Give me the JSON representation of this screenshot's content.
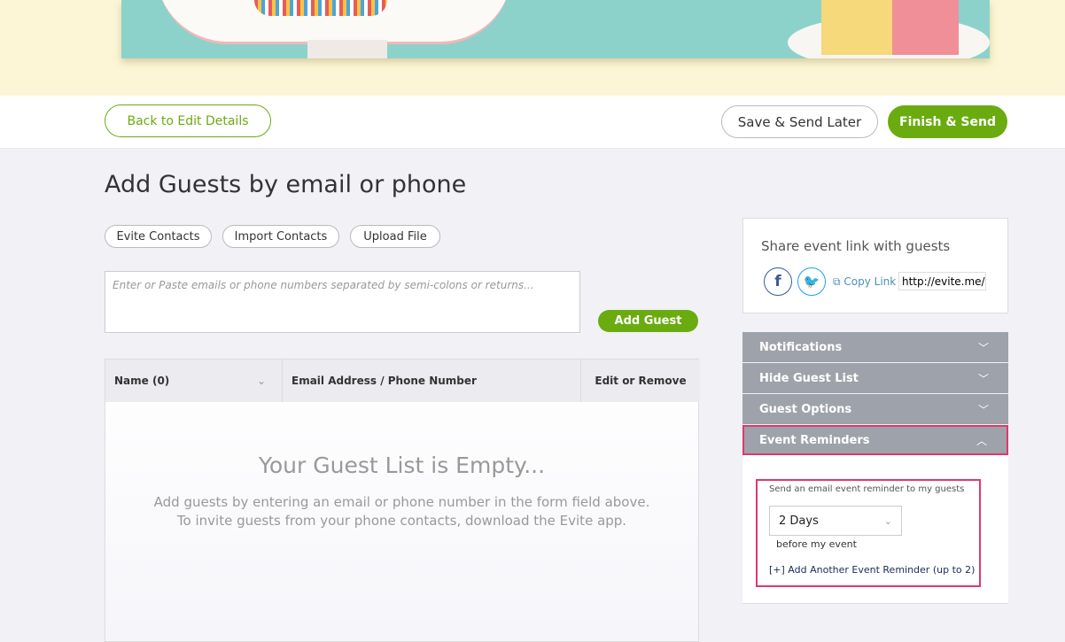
{
  "toolbar": {
    "back": "Back to Edit Details",
    "save_later": "Save & Send Later",
    "finish": "Finish & Send"
  },
  "colors": {
    "accent": "#6aab10",
    "highlight": "#e0386e",
    "accordion": "#9ea3ab"
  },
  "main": {
    "title": "Add Guests by email or phone",
    "sources": [
      "Evite Contacts",
      "Import Contacts",
      "Upload File"
    ],
    "input_placeholder": "Enter or Paste emails or phone numbers separated by semi-colons or returns...",
    "add_guest": "Add Guest",
    "columns": [
      "Name (0)",
      "Email Address / Phone Number",
      "Edit or Remove"
    ],
    "empty_title": "Your Guest List is Empty...",
    "empty_line1": "Add guests by entering an email or phone number in the form field above.",
    "empty_line2": "To invite guests from your phone contacts, download the Evite app."
  },
  "share": {
    "title": "Share event link with guests",
    "copy": "Copy Link",
    "link": "http://evite.me/EV"
  },
  "accordion": [
    {
      "label": "Notifications",
      "icon": "chevron-down-icon"
    },
    {
      "label": "Hide Guest List",
      "icon": "chevron-down-icon"
    },
    {
      "label": "Guest Options",
      "icon": "chevron-down-icon"
    },
    {
      "label": "Event Reminders",
      "icon": "chevron-up-icon"
    }
  ],
  "reminders": {
    "label": "Send an email event reminder to my guests",
    "value": "2 Days",
    "after": "before my event",
    "add": "[+] Add Another Event Reminder (up to 2)"
  }
}
